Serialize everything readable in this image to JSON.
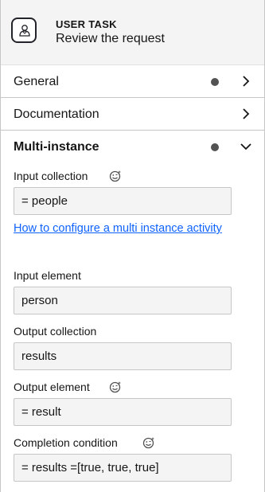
{
  "header": {
    "type": "USER TASK",
    "name": "Review the request",
    "icon": "user-task-icon"
  },
  "groups": [
    {
      "label": "General",
      "has_dot": true,
      "chevron": "right"
    },
    {
      "label": "Documentation",
      "has_dot": false,
      "chevron": "right"
    },
    {
      "label": "Multi-instance",
      "has_dot": true,
      "chevron": "down"
    }
  ],
  "multi_instance": {
    "input_collection": {
      "label": "Input collection",
      "value": "= people",
      "feel": true
    },
    "help_link": "How to configure a multi instance activity",
    "input_element": {
      "label": "Input element",
      "value": "person"
    },
    "output_collection": {
      "label": "Output collection",
      "value": "results"
    },
    "output_element": {
      "label": "Output element",
      "value": "= result",
      "feel": true
    },
    "completion_condition": {
      "label": "Completion condition",
      "value": "= results =[true, true, true]",
      "feel": true
    }
  },
  "colors": {
    "header_bg": "#f4f4f4",
    "input_bg": "#f4f4f4",
    "border": "#c6c6c6",
    "dot": "#525252",
    "link": "#0f62fe"
  }
}
